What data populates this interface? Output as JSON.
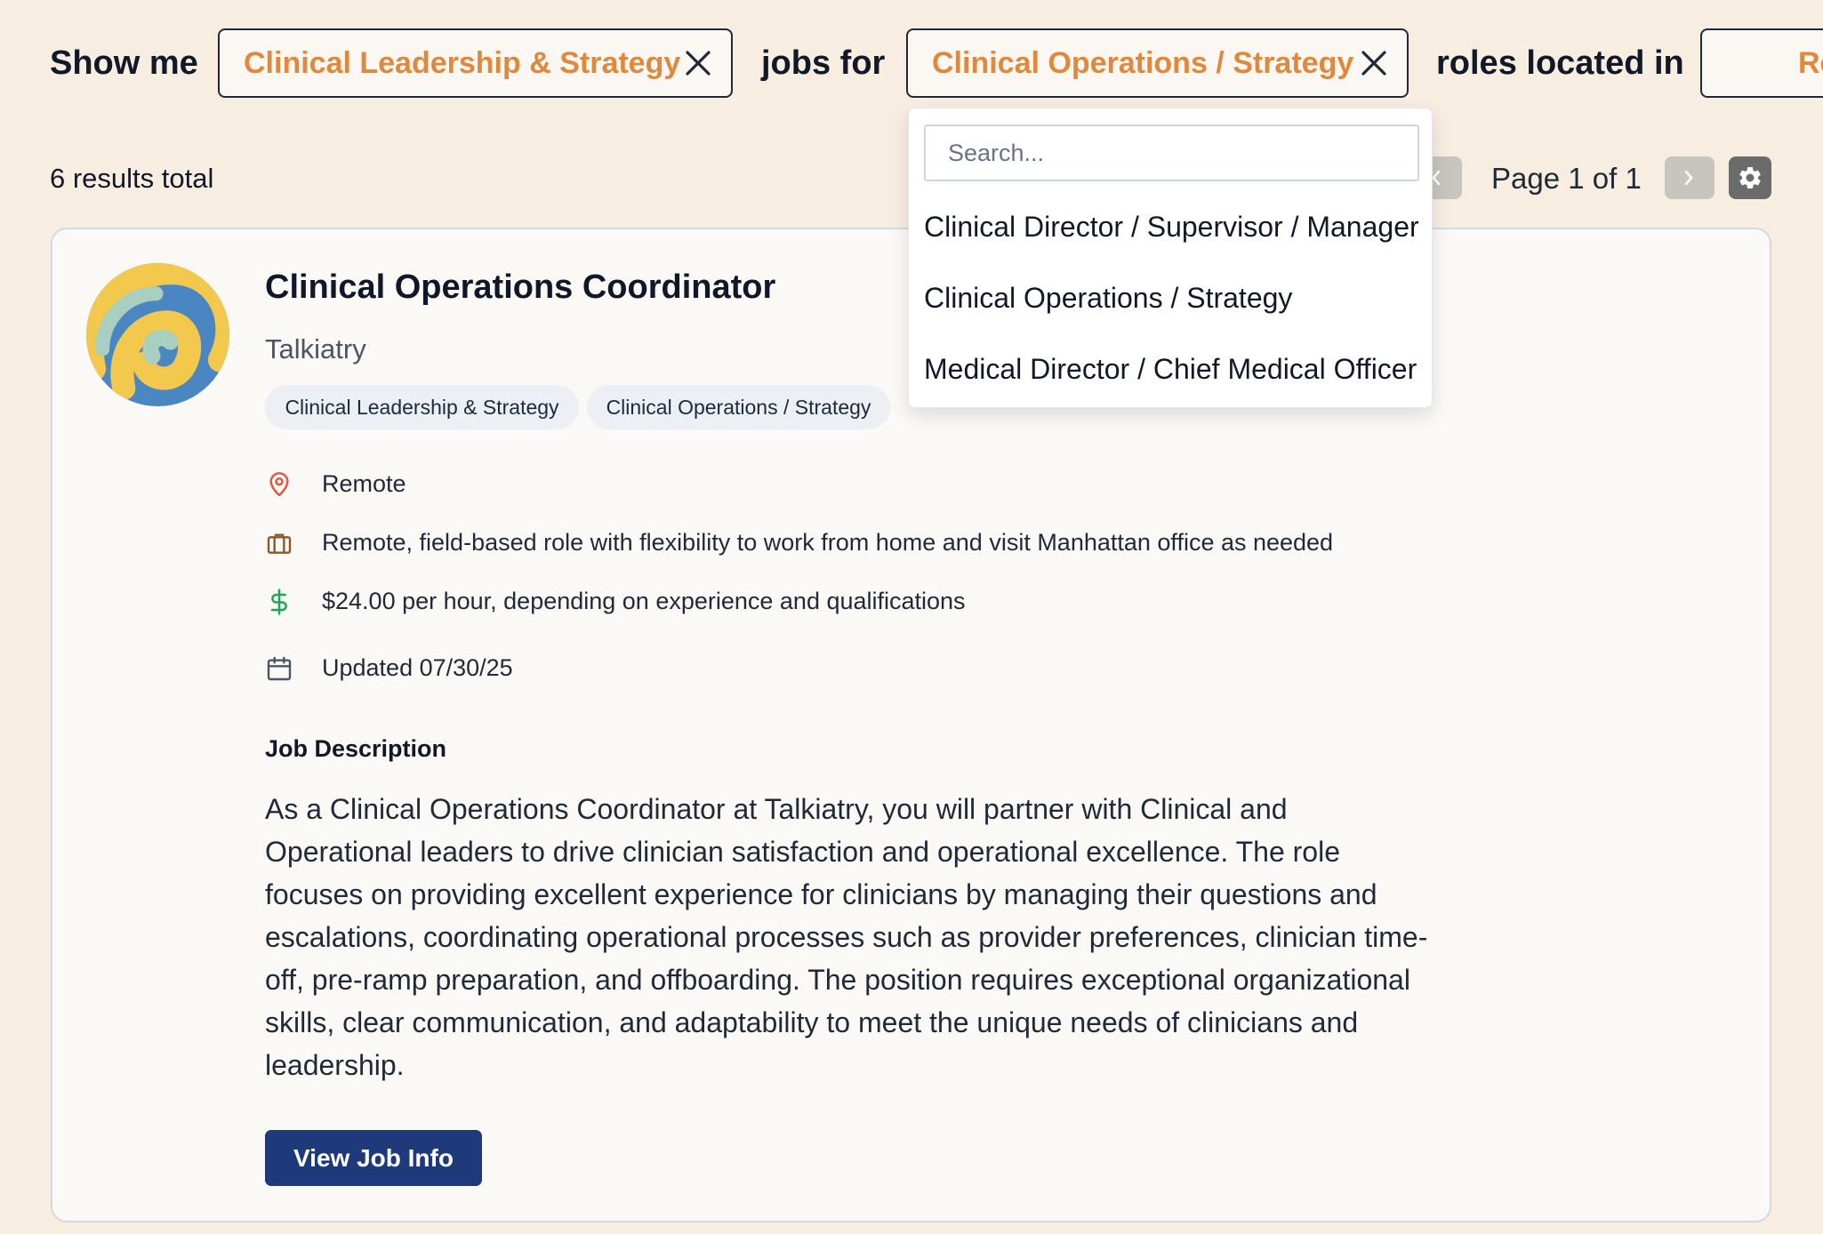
{
  "filters": {
    "show_me": "Show me",
    "category_chip": "Clinical Leadership & Strategy",
    "jobs_for": "jobs for",
    "role_chip": "Clinical Operations / Strategy",
    "roles_located_in": "roles located in",
    "location_chip_partial": "Re"
  },
  "results": {
    "total_text": "6 results total",
    "page_label": "Page 1 of 1"
  },
  "dropdown": {
    "search_placeholder": "Search...",
    "options": [
      "Clinical Director / Supervisor / Manager",
      "Clinical Operations / Strategy",
      "Medical Director / Chief Medical Officer"
    ]
  },
  "job": {
    "title": "Clinical Operations Coordinator",
    "company": "Talkiatry",
    "tags": [
      "Clinical Leadership & Strategy",
      "Clinical Operations / Strategy"
    ],
    "location": "Remote",
    "work_type": "Remote, field-based role with flexibility to work from home and visit Manhattan office as needed",
    "salary": "$24.00 per hour, depending on experience and qualifications",
    "updated": "Updated 07/30/25",
    "description_heading": "Job Description",
    "description": "As a Clinical Operations Coordinator at Talkiatry, you will partner with Clinical and Operational leaders to drive clinician satisfaction and operational excellence. The role focuses on providing excellent experience for clinicians by managing their questions and escalations, coordinating operational processes such as provider preferences, clinician time-off, pre-ramp preparation, and offboarding. The position requires exceptional organizational skills, clear communication, and adaptability to meet the unique needs of clinicians and leadership.",
    "view_button": "View Job Info"
  },
  "colors": {
    "background": "#f7ede0",
    "chip_text": "#e0893c",
    "primary_button": "#1e3a7b",
    "location_icon": "#e5533d",
    "salary_icon": "#22a55a"
  },
  "icons": [
    "close-icon",
    "chevron-left-icon",
    "chevron-right-icon",
    "gear-icon",
    "map-pin-icon",
    "briefcase-icon",
    "dollar-icon",
    "calendar-icon"
  ]
}
